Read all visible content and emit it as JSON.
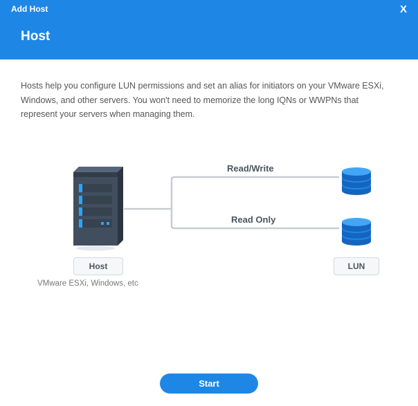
{
  "titlebar": {
    "title": "Add Host",
    "close": "X"
  },
  "header": {
    "title": "Host"
  },
  "body": {
    "description": "Hosts help you configure LUN permissions and set an alias for initiators on your VMware ESXi, Windows, and other servers. You won't need to memorize the long IQNs or WWPNs that represent your servers when managing them."
  },
  "diagram": {
    "host_label": "Host",
    "host_caption": "VMware ESXi, Windows, etc",
    "lun_label": "LUN",
    "conn_readwrite": "Read/Write",
    "conn_readonly": "Read Only"
  },
  "footer": {
    "start": "Start"
  }
}
